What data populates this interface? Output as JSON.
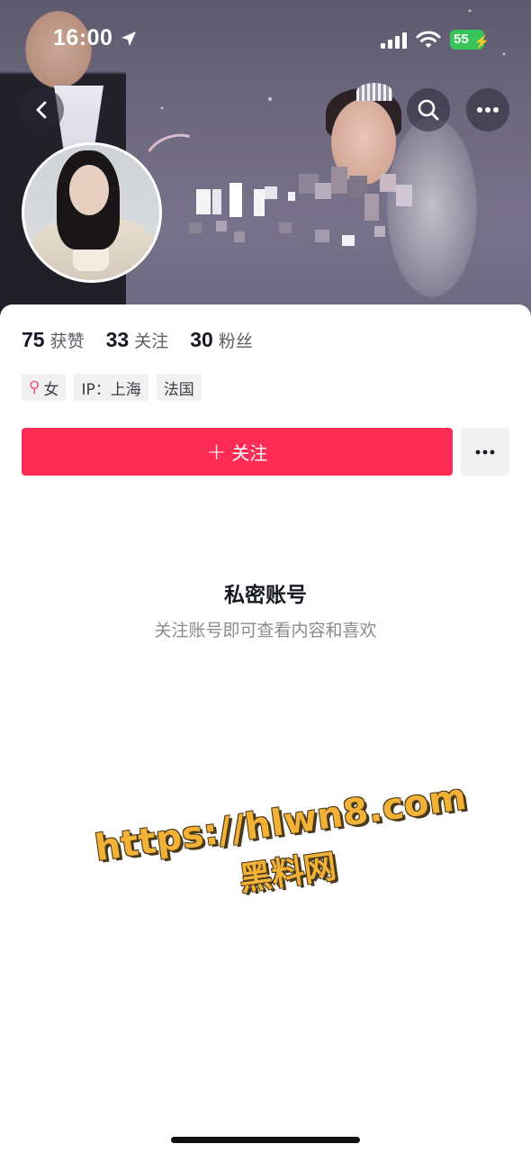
{
  "status_bar": {
    "time": "16:00",
    "battery": "55",
    "location_icon": "location-arrow-icon",
    "signal_icon": "cell-signal-icon",
    "wifi_icon": "wifi-icon"
  },
  "header": {
    "back_icon": "chevron-left-icon",
    "search_icon": "search-icon",
    "more_icon": "more-dots-icon"
  },
  "profile": {
    "stats": [
      {
        "value": "75",
        "label": "获赞"
      },
      {
        "value": "33",
        "label": "关注"
      },
      {
        "value": "30",
        "label": "粉丝"
      }
    ],
    "tags": {
      "gender": "女",
      "ip": "IP：上海",
      "location": "法国"
    },
    "follow_button": "关注",
    "follow_button_icon": "plus-icon"
  },
  "private_notice": {
    "title": "私密账号",
    "subtitle": "关注账号即可查看内容和喜欢"
  },
  "watermark": {
    "url": "https://hlwn8.com",
    "name": "黑料网"
  },
  "colors": {
    "accent": "#fe2c55",
    "gender_female": "#e8508a",
    "battery": "#37c55a"
  }
}
